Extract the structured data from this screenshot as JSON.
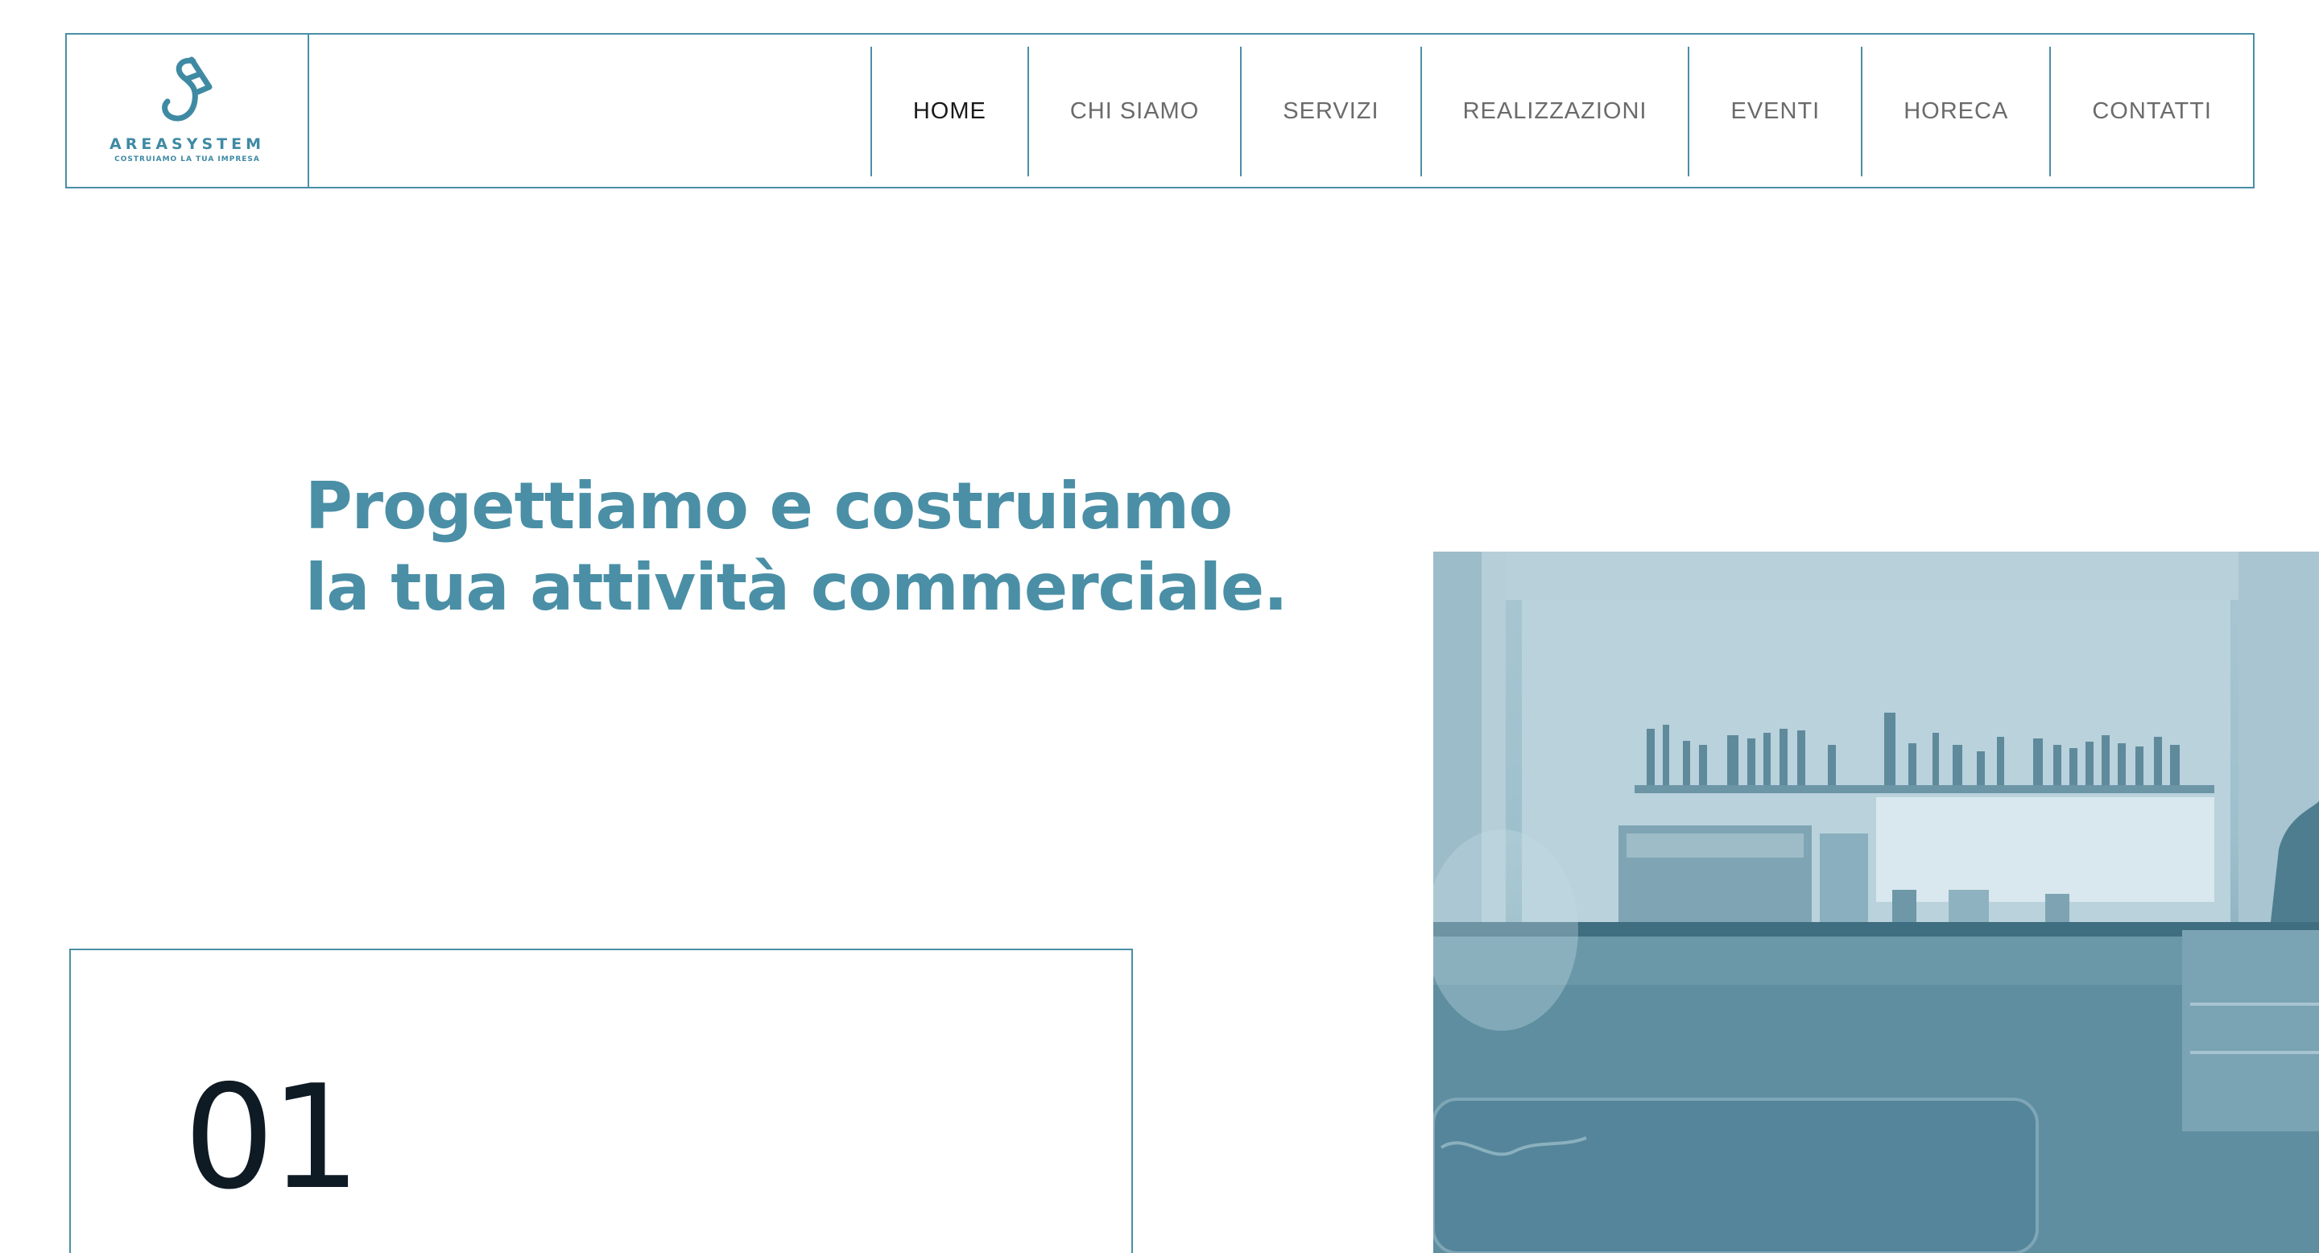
{
  "logo": {
    "name": "AREASYSTEM",
    "tagline": "COSTRUIAMO LA TUA IMPRESA"
  },
  "nav": {
    "items": [
      {
        "label": "HOME",
        "active": true
      },
      {
        "label": "CHI SIAMO",
        "active": false
      },
      {
        "label": "SERVIZI",
        "active": false
      },
      {
        "label": "REALIZZAZIONI",
        "active": false
      },
      {
        "label": "EVENTI",
        "active": false
      },
      {
        "label": "HORECA",
        "active": false
      },
      {
        "label": "CONTATTI",
        "active": false
      }
    ]
  },
  "hero": {
    "title_line1": "Progettiamo e costruiamo",
    "title_line2": "la tua attività commerciale."
  },
  "card": {
    "number": "01"
  },
  "colors": {
    "accent": "#4a8fa6",
    "text_dark": "#0e1a24",
    "nav_text": "#6b6b6b"
  }
}
